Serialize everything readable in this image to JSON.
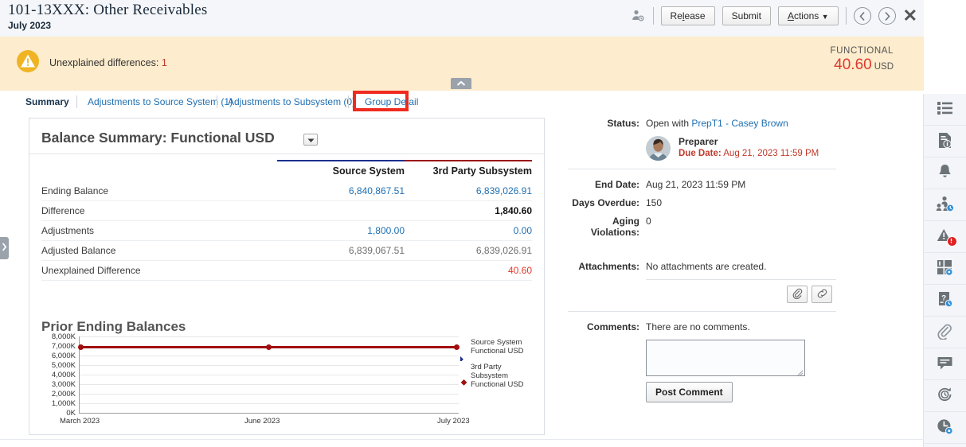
{
  "header": {
    "title": "101-13XXX: Other Receivables",
    "period": "July 2023",
    "assignee_icon": "user-assign-icon",
    "release_label": "Release",
    "release_accesskey": "l",
    "submit_label": "Submit",
    "actions_label": "Actions",
    "actions_accesskey": "A",
    "prev_icon": "chevron-left-circle-icon",
    "next_icon": "chevron-right-circle-icon",
    "close_icon": "close-icon"
  },
  "banner": {
    "warning_icon": "warning-triangle-icon",
    "message": "Unexplained differences:",
    "count": "1",
    "functional_label": "FUNCTIONAL",
    "functional_amount": "40.60",
    "functional_currency": "USD",
    "collapse_icon": "chevron-up-icon",
    "bg_color": "#fdeccd",
    "amount_color": "#e0392b"
  },
  "tabs": [
    {
      "label": "Summary",
      "active": true
    },
    {
      "label": "Adjustments to Source System (1)",
      "active": false
    },
    {
      "label": "Adjustments to Subsystem (0)",
      "active": false
    },
    {
      "label": "Group Detail",
      "active": false,
      "annotated": true
    }
  ],
  "annotation": {
    "color": "#ef2b1f"
  },
  "balance_summary": {
    "title": "Balance Summary: Functional USD",
    "dropdown_icon": "chevron-down-icon",
    "columns": [
      "",
      "Source System",
      "3rd Party Subsystem"
    ],
    "column_rule_colors": [
      "",
      "#1b2f8f",
      "#9b1616"
    ],
    "rows": [
      {
        "label": "Ending Balance",
        "source": "6,840,867.51",
        "subsystem": "6,839,026.91",
        "source_style": "link",
        "subsystem_style": "link"
      },
      {
        "label": "Difference",
        "source": "",
        "subsystem": "1,840.60",
        "source_style": "plain",
        "subsystem_style": "bold"
      },
      {
        "label": "Adjustments",
        "source": "1,800.00",
        "subsystem": "0.00",
        "source_style": "link",
        "subsystem_style": "link"
      },
      {
        "label": "Adjusted Balance",
        "source": "6,839,067.51",
        "subsystem": "6,839,026.91",
        "source_style": "grey",
        "subsystem_style": "grey"
      },
      {
        "label": "Unexplained Difference",
        "source": "",
        "subsystem": "40.60",
        "source_style": "plain",
        "subsystem_style": "red"
      }
    ]
  },
  "chart_data": {
    "type": "line",
    "title": "Prior Ending Balances",
    "xlabel": "",
    "ylabel": "",
    "categories": [
      "March 2023",
      "June 2023",
      "July 2023"
    ],
    "ytick_labels": [
      "8,000K",
      "7,000K",
      "6,000K",
      "5,000K",
      "4,000K",
      "3,000K",
      "2,000K",
      "1,000K",
      "0K"
    ],
    "ylim": [
      0,
      8000
    ],
    "grid": true,
    "legend_position": "right",
    "series": [
      {
        "name": "Source System Functional USD",
        "color": "#1b2f8f",
        "marker": "diamond",
        "values": [
          6840.87,
          6840.87,
          6840.87
        ]
      },
      {
        "name": "3rd Party Subsystem Functional USD",
        "color": "#a01010",
        "marker": "diamond",
        "values": [
          6839.03,
          6839.03,
          6839.03
        ]
      }
    ]
  },
  "details": {
    "status_label": "Status:",
    "status_prefix": "Open with",
    "status_link": "PrepT1 - Casey Brown",
    "preparer_role": "Preparer",
    "due_date_label": "Due Date:",
    "due_date_value": "Aug 21, 2023 11:59 PM",
    "end_date_label": "End Date:",
    "end_date_value": "Aug 21, 2023 11:59 PM",
    "days_overdue_label": "Days Overdue:",
    "days_overdue_value": "150",
    "aging_violations_label": "Aging Violations:",
    "aging_violations_value": "0",
    "attachments_label": "Attachments:",
    "attachments_value": "No attachments are created.",
    "attach_file_icon": "paperclip-icon",
    "attach_link_icon": "link-icon",
    "comments_label": "Comments:",
    "comments_value": "There are no comments.",
    "comment_input_value": "",
    "comment_input_placeholder": "",
    "post_comment_label": "Post Comment"
  },
  "rail": [
    {
      "icon": "list-icon",
      "badge": false
    },
    {
      "icon": "document-info-icon",
      "badge": false
    },
    {
      "icon": "bell-icon",
      "badge": false
    },
    {
      "icon": "workflow-users-icon",
      "badge": false
    },
    {
      "icon": "alert-triangle-icon",
      "badge": true
    },
    {
      "icon": "dashboard-icon",
      "badge": false
    },
    {
      "icon": "question-doc-icon",
      "badge": false
    },
    {
      "icon": "paperclip-icon",
      "badge": false
    },
    {
      "icon": "comment-icon",
      "badge": false
    },
    {
      "icon": "history-refresh-icon",
      "badge": false
    },
    {
      "icon": "clock-icon",
      "badge": false
    }
  ],
  "left_handle_icon": "chevron-right-icon"
}
